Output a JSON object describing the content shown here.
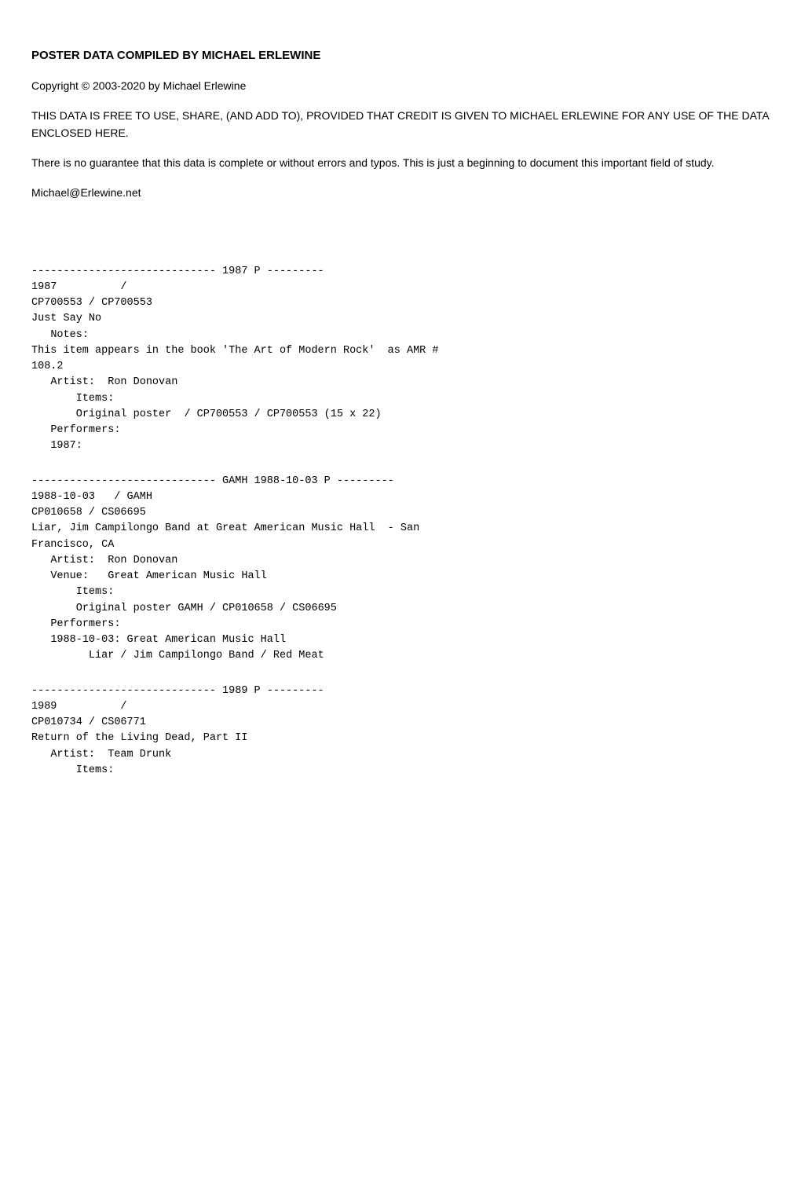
{
  "header": {
    "title": "POSTER DATA COMPILED BY MICHAEL ERLEWINE",
    "copyright": "Copyright © 2003-2020 by Michael Erlewine",
    "license": "THIS DATA IS FREE TO USE, SHARE, (AND ADD TO), PROVIDED THAT CREDIT IS GIVEN TO MICHAEL ERLEWINE FOR ANY USE OF THE DATA ENCLOSED HERE.",
    "disclaimer": "There is no guarantee that this data is complete or without errors and typos. This is just a beginning to document this important field of study.",
    "email": "Michael@Erlewine.net"
  },
  "records": [
    {
      "id": "record-1987",
      "content": "----------------------------- 1987 P ---------\n1987          /\nCP700553 / CP700553\nJust Say No\n   Notes:\nThis item appears in the book 'The Art of Modern Rock'  as AMR #\n108.2\n   Artist:  Ron Donovan\n       Items:\n       Original poster  / CP700553 / CP700553 (15 x 22)\n   Performers:\n   1987:"
    },
    {
      "id": "record-gamh",
      "content": "----------------------------- GAMH 1988-10-03 P ---------\n1988-10-03   / GAMH\nCP010658 / CS06695\nLiar, Jim Campilongo Band at Great American Music Hall  - San\nFrancisco, CA\n   Artist:  Ron Donovan\n   Venue:   Great American Music Hall\n       Items:\n       Original poster GAMH / CP010658 / CS06695\n   Performers:\n   1988-10-03: Great American Music Hall\n         Liar / Jim Campilongo Band / Red Meat"
    },
    {
      "id": "record-1989",
      "content": "----------------------------- 1989 P ---------\n1989          /\nCP010734 / CS06771\nReturn of the Living Dead, Part II\n   Artist:  Team Drunk\n       Items:"
    }
  ]
}
